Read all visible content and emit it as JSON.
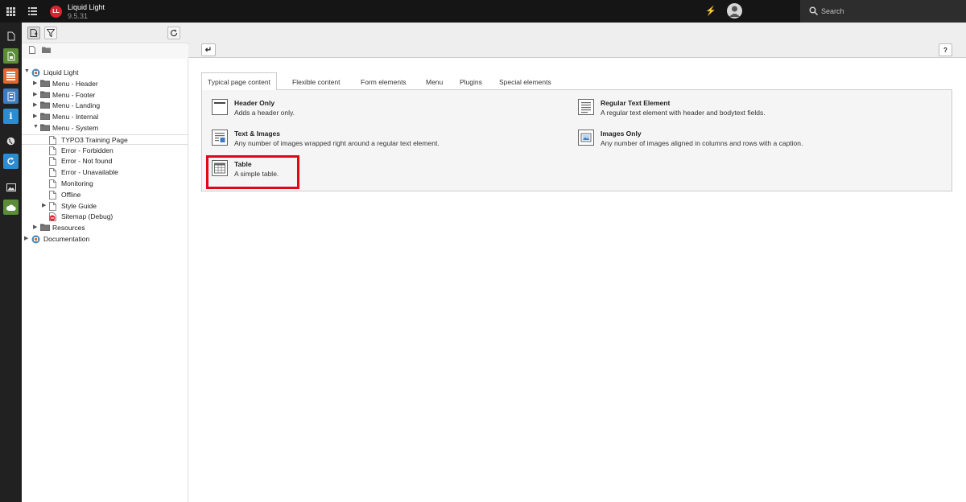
{
  "topbar": {
    "site_name": "Liquid Light",
    "site_version": "9.5.31",
    "logo_text": "LL",
    "search_label": "Search"
  },
  "module_menu": {
    "items": [
      {
        "icon": "page-icon",
        "color": "#212121"
      },
      {
        "icon": "view-icon",
        "color": "#5a8c3a"
      },
      {
        "icon": "list-icon",
        "color": "#e0682c"
      },
      {
        "icon": "form-icon",
        "color": "#3f7bc1"
      },
      {
        "icon": "info-icon",
        "color": "#2c8cd1"
      },
      {
        "icon": "globe-icon",
        "color": "#212121"
      },
      {
        "icon": "sync-icon",
        "color": "#2c8cd1"
      },
      {
        "icon": "image-icon",
        "color": "#212121"
      },
      {
        "icon": "cloud-icon",
        "color": "#5a8c3a"
      }
    ]
  },
  "page_tree": {
    "nodes": [
      {
        "label": "Liquid Light",
        "level": 0,
        "arrow": "▼",
        "icon": "site-root-icon"
      },
      {
        "label": "Menu - Header",
        "level": 1,
        "arrow": "▶",
        "icon": "folder-icon"
      },
      {
        "label": "Menu - Footer",
        "level": 1,
        "arrow": "▶",
        "icon": "folder-icon"
      },
      {
        "label": "Menu - Landing",
        "level": 1,
        "arrow": "▶",
        "icon": "folder-icon"
      },
      {
        "label": "Menu - Internal",
        "level": 1,
        "arrow": "▶",
        "icon": "folder-icon"
      },
      {
        "label": "Menu - System",
        "level": 1,
        "arrow": "▼",
        "icon": "folder-icon"
      },
      {
        "label": "TYPO3 Training Page",
        "level": 2,
        "arrow": "",
        "icon": "page-icon",
        "selected": true
      },
      {
        "label": "Error - Forbidden",
        "level": 2,
        "arrow": "",
        "icon": "page-icon"
      },
      {
        "label": "Error - Not found",
        "level": 2,
        "arrow": "",
        "icon": "page-icon"
      },
      {
        "label": "Error - Unavailable",
        "level": 2,
        "arrow": "",
        "icon": "page-icon"
      },
      {
        "label": "Monitoring",
        "level": 2,
        "arrow": "",
        "icon": "page-icon"
      },
      {
        "label": "Offline",
        "level": 2,
        "arrow": "",
        "icon": "page-icon"
      },
      {
        "label": "Style Guide",
        "level": 2,
        "arrow": "▶",
        "icon": "page-icon"
      },
      {
        "label": "Sitemap (Debug)",
        "level": 2,
        "arrow": "",
        "icon": "sitemap-icon"
      },
      {
        "label": "Resources",
        "level": 1,
        "arrow": "▶",
        "icon": "folder-icon"
      },
      {
        "label": "Documentation",
        "level": 0,
        "arrow": "▶",
        "icon": "site-root-icon"
      }
    ]
  },
  "docheader": {
    "back_label": "↵",
    "help_label": "?"
  },
  "wizard": {
    "tabs": [
      {
        "label": "Typical page content",
        "active": true
      },
      {
        "label": "Flexible content"
      },
      {
        "label": "Form elements"
      },
      {
        "label": "Menu"
      },
      {
        "label": "Plugins"
      },
      {
        "label": "Special elements"
      }
    ],
    "elements": [
      {
        "title": "Header Only",
        "description": "Adds a header only.",
        "icon": "header-element-icon"
      },
      {
        "title": "Regular Text Element",
        "description": "A regular text element with header and bodytext fields.",
        "icon": "text-element-icon"
      },
      {
        "title": "Text & Images",
        "description": "Any number of images wrapped right around a regular text element.",
        "icon": "text-images-element-icon"
      },
      {
        "title": "Images Only",
        "description": "Any number of images aligned in columns and rows with a caption.",
        "icon": "images-element-icon"
      },
      {
        "title": "Table",
        "description": "A simple table.",
        "icon": "table-element-icon",
        "highlighted": true
      }
    ]
  }
}
